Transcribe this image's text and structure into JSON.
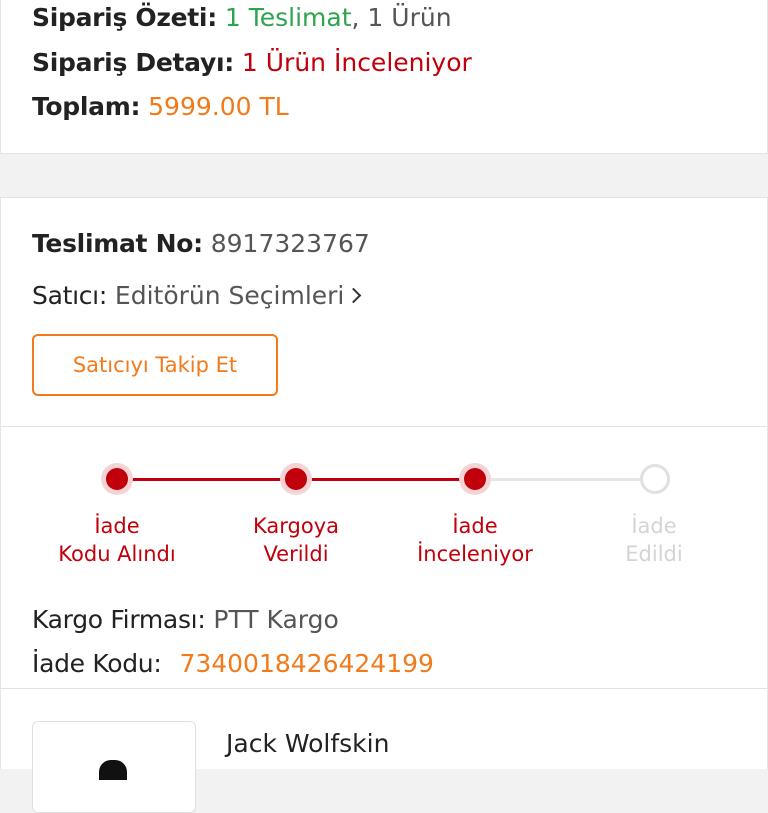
{
  "summary": {
    "order_summary_label": "Sipariş Özeti:",
    "order_summary_deliveries": "1 Teslimat",
    "order_summary_sep": ",",
    "order_summary_items": "1 Ürün",
    "order_detail_label": "Sipariş Detayı:",
    "order_detail_value": "1 Ürün İnceleniyor",
    "total_label": "Toplam:",
    "total_value": "5999.00 TL"
  },
  "delivery": {
    "delivery_no_label": "Teslimat No:",
    "delivery_no_value": "8917323767",
    "seller_label": "Satıcı:",
    "seller_value": "Editörün Seçimleri",
    "follow_button_label": "Satıcıyı Takip Et"
  },
  "tracker": {
    "steps": [
      {
        "line1": "İade",
        "line2": "Kodu Alındı",
        "status": "done"
      },
      {
        "line1": "Kargoya",
        "line2": "Verildi",
        "status": "done"
      },
      {
        "line1": "İade",
        "line2": "İnceleniyor",
        "status": "done"
      },
      {
        "line1": "İade",
        "line2": "Edildi",
        "status": "todo"
      }
    ],
    "colors": {
      "active": "#c2000b",
      "inactive": "#e0e0e0"
    }
  },
  "return_info": {
    "cargo_label": "Kargo Firması:",
    "cargo_value": "PTT Kargo",
    "return_code_label": "İade Kodu:",
    "return_code_value": "7340018426424199"
  },
  "product": {
    "brand": "Jack Wolfskin",
    "thumbnail_icon": "product-image"
  },
  "colors": {
    "accent": "#f27a1a",
    "success": "#2ea44f",
    "alert": "#c2000b"
  }
}
